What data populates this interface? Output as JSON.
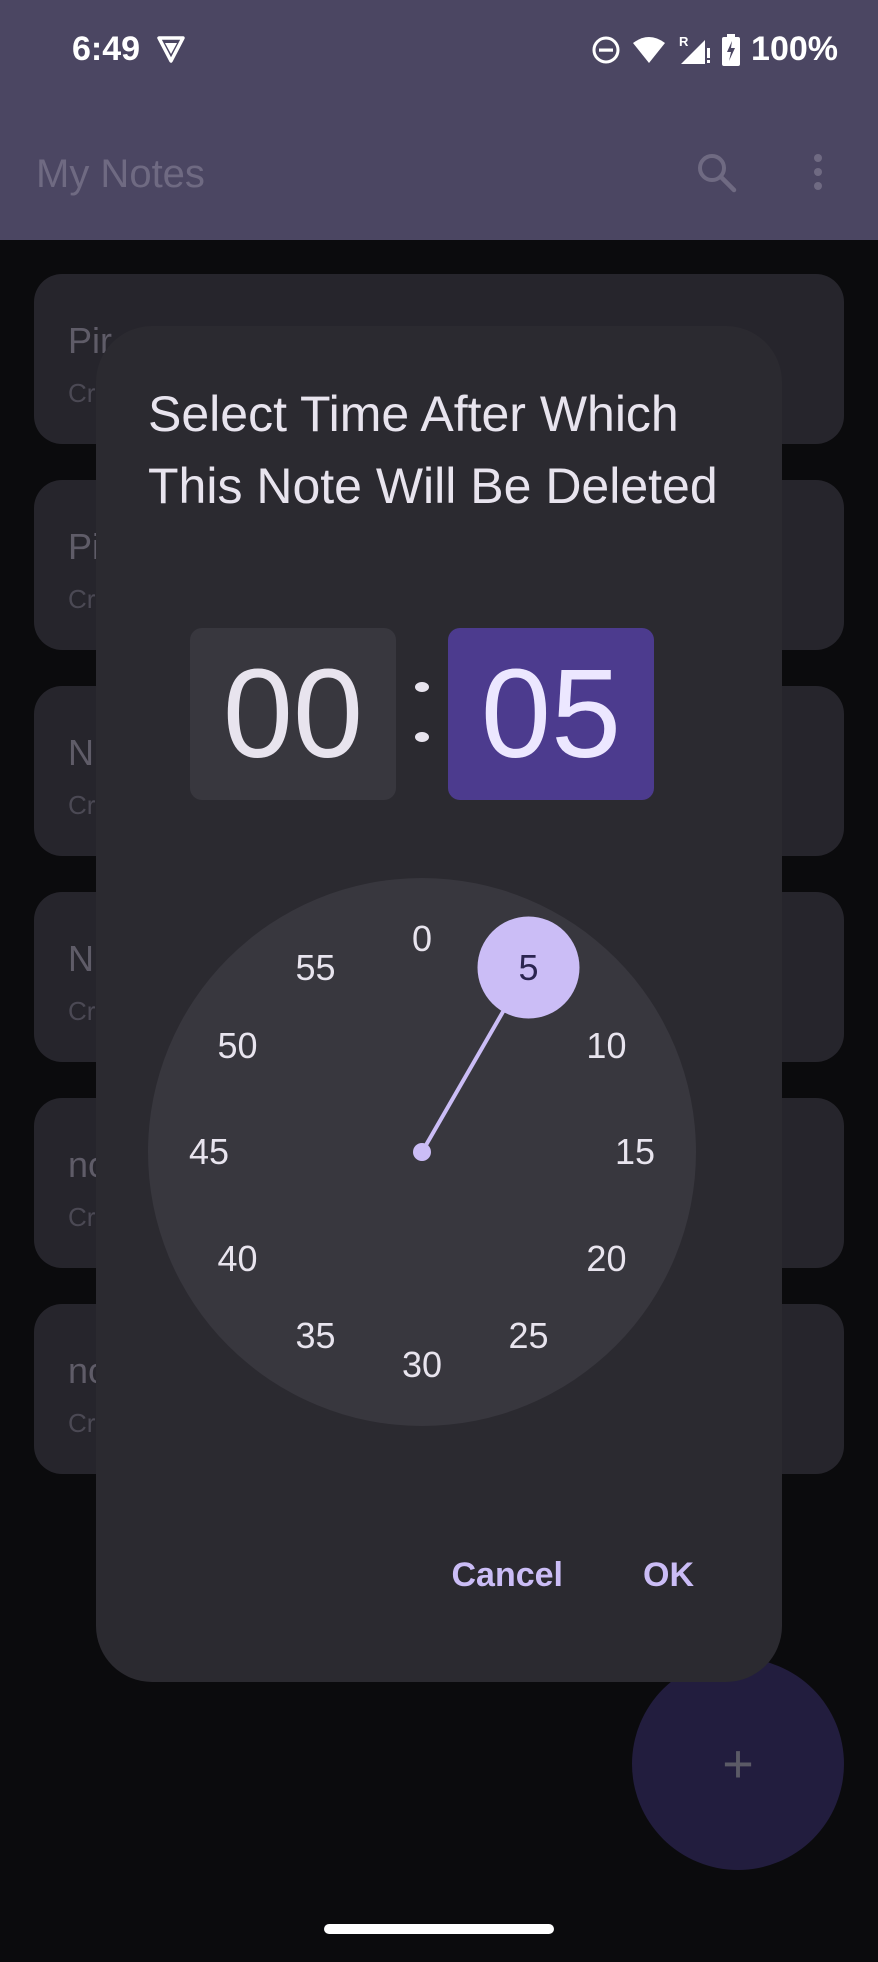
{
  "status_bar": {
    "time": "6:49",
    "battery": "100%",
    "icons": [
      "vpn-key-icon",
      "do-not-disturb-icon",
      "wifi-icon",
      "signal-roaming-icon",
      "battery-charging-icon"
    ]
  },
  "app_bar": {
    "title": "My Notes",
    "icons": [
      "search-icon",
      "more-vert-icon"
    ]
  },
  "notes": [
    {
      "title": "Pir",
      "subtitle": "Cr"
    },
    {
      "title": "Pi",
      "subtitle": "Cr"
    },
    {
      "title": "N",
      "subtitle": "Cr"
    },
    {
      "title": "N",
      "subtitle": "Cr"
    },
    {
      "title": "no",
      "subtitle": "Cr"
    },
    {
      "title": "no",
      "subtitle": "Cr"
    }
  ],
  "fab": {
    "icon": "plus-icon",
    "label": "+"
  },
  "dialog": {
    "title": "Select Time After Which This Note Will Be Deleted",
    "hour": "00",
    "separator": ":",
    "minute": "05",
    "selected_minute": 5,
    "clock_labels": [
      "0",
      "5",
      "10",
      "15",
      "20",
      "25",
      "30",
      "35",
      "40",
      "45",
      "50",
      "55"
    ],
    "cancel_label": "Cancel",
    "ok_label": "OK"
  },
  "colors": {
    "app_bar": "#4b4662",
    "dialog_bg": "#2b2a30",
    "accent": "#cbbdf6",
    "minute_box": "#4c3b8e",
    "selected_handle": "#cbbdf6"
  }
}
